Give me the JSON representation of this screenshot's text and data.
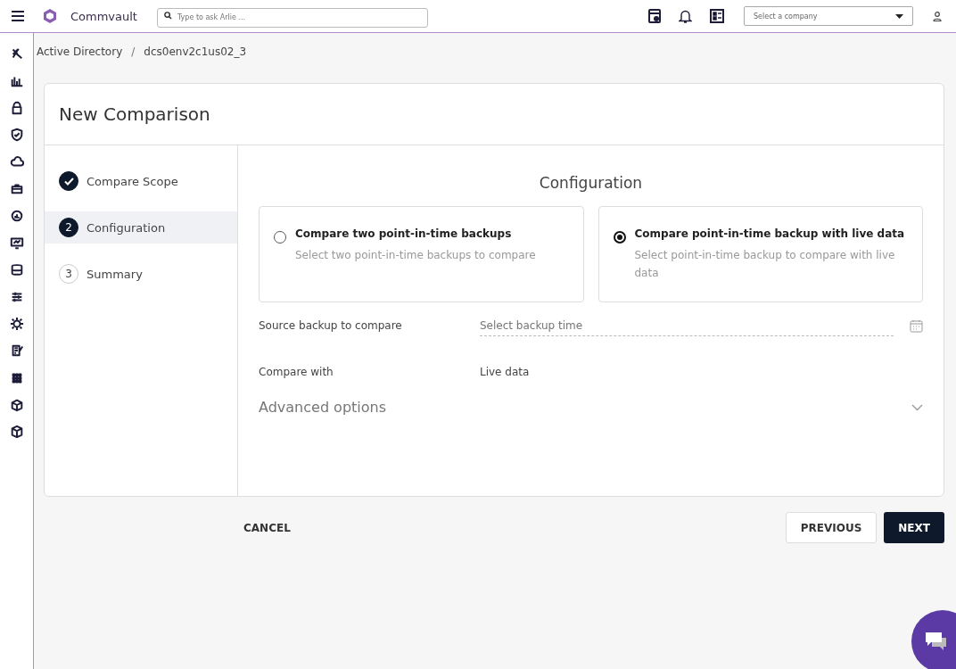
{
  "header": {
    "brand": "Commvault",
    "search": {
      "placeholder": "Type to ask Arlie ..."
    },
    "company_select": {
      "placeholder": "Select a company"
    }
  },
  "breadcrumb": [
    "Active Directory",
    "dcs0env2c1us02_3"
  ],
  "breadcrumb_separator": "/",
  "title": "New Comparison",
  "steps": [
    {
      "label": "Compare Scope",
      "kind": "done",
      "selected": false
    },
    {
      "number": "2",
      "label": "Configuration",
      "kind": "current",
      "selected": true
    },
    {
      "number": "3",
      "label": "Summary",
      "kind": "pending",
      "selected": false
    }
  ],
  "section_title": "Configuration",
  "options": [
    {
      "title": "Compare two point-in-time backups",
      "description": "Select two point-in-time backups to compare",
      "selected": false
    },
    {
      "title": "Compare point-in-time backup with live data",
      "description": "Select point-in-time backup to compare with live data",
      "selected": true
    }
  ],
  "fields": [
    {
      "label": "Source backup to compare",
      "kind": "date",
      "placeholder": "Select backup time"
    },
    {
      "label": "Compare with",
      "kind": "text",
      "value": "Live data"
    }
  ],
  "advanced": {
    "label": "Advanced options",
    "expanded": false
  },
  "buttons": {
    "cancel": "CANCEL",
    "previous": "PREVIOUS",
    "next": "NEXT"
  }
}
